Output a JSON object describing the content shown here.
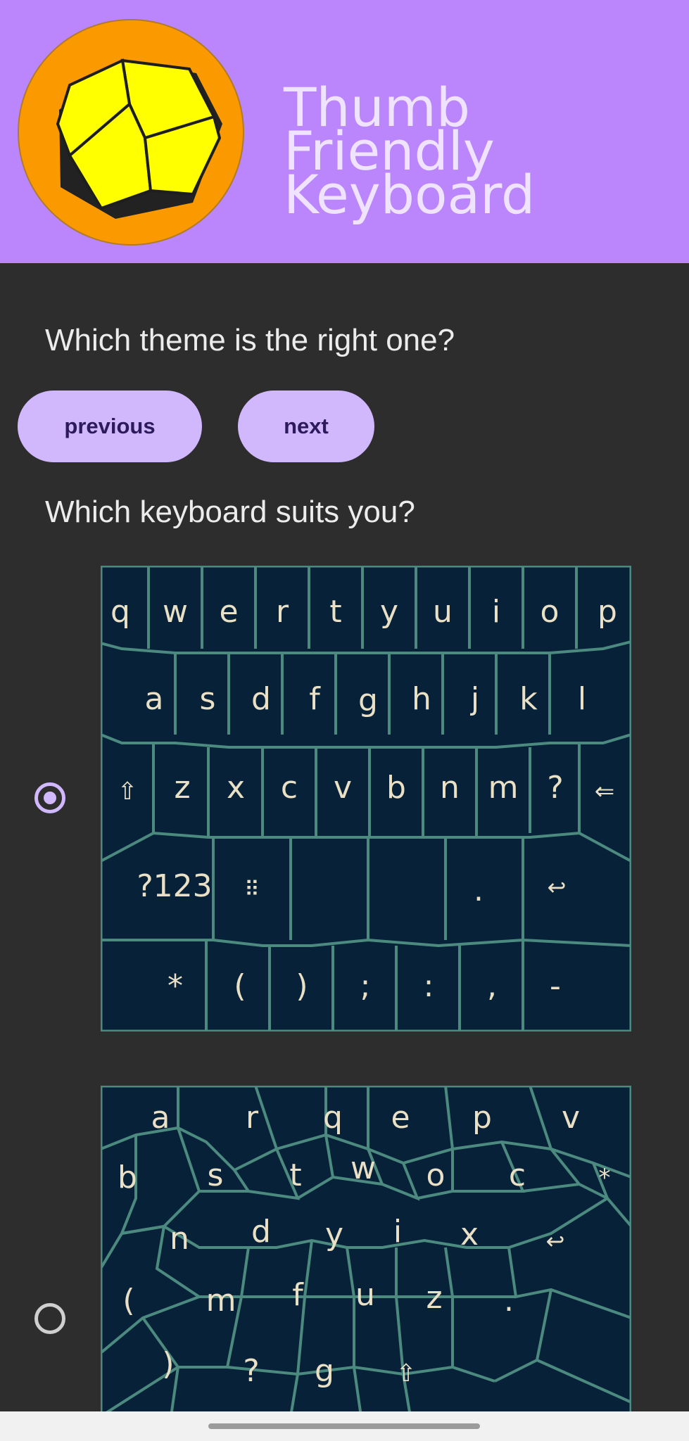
{
  "app": {
    "title_line1": "Thumb Friendly",
    "title_line2": "Keyboard",
    "logo_icon": "dodecahedron-logo-icon"
  },
  "theme": {
    "question": "Which theme is the right one?",
    "previous_label": "previous",
    "next_label": "next"
  },
  "keyboard_choice": {
    "question": "Which keyboard suits you?",
    "selected": 0,
    "options": [
      {
        "name": "qwerty-keyboard-preview",
        "rows": [
          [
            "q",
            "w",
            "e",
            "r",
            "t",
            "y",
            "u",
            "i",
            "o",
            "p"
          ],
          [
            "a",
            "s",
            "d",
            "f",
            "g",
            "h",
            "j",
            "k",
            "l"
          ],
          [
            "⇧",
            "z",
            "x",
            "c",
            "v",
            "b",
            "n",
            "m",
            "?",
            "⇐"
          ],
          [
            "?123",
            "⠿",
            "",
            ".",
            "↩"
          ],
          [
            "*",
            "(",
            ")",
            ";",
            ":",
            ",",
            "-"
          ]
        ]
      },
      {
        "name": "honeycomb-keyboard-preview",
        "keys": [
          "a",
          "r",
          "q",
          "e",
          "p",
          "v",
          "b",
          "s",
          "t",
          "w",
          "o",
          "c",
          "*",
          "n",
          "d",
          "y",
          "i",
          "x",
          "↩",
          "(",
          "m",
          "f",
          "u",
          "z",
          ".",
          ")",
          "?",
          "g",
          "⇧"
        ]
      }
    ]
  },
  "colors": {
    "header_bg": "#bb86fc",
    "body_bg": "#2d2d2d",
    "button_bg": "#d1b8fd",
    "key_bg": "#072238",
    "key_border": "#4c8a80",
    "key_text": "#e9e0c6"
  }
}
